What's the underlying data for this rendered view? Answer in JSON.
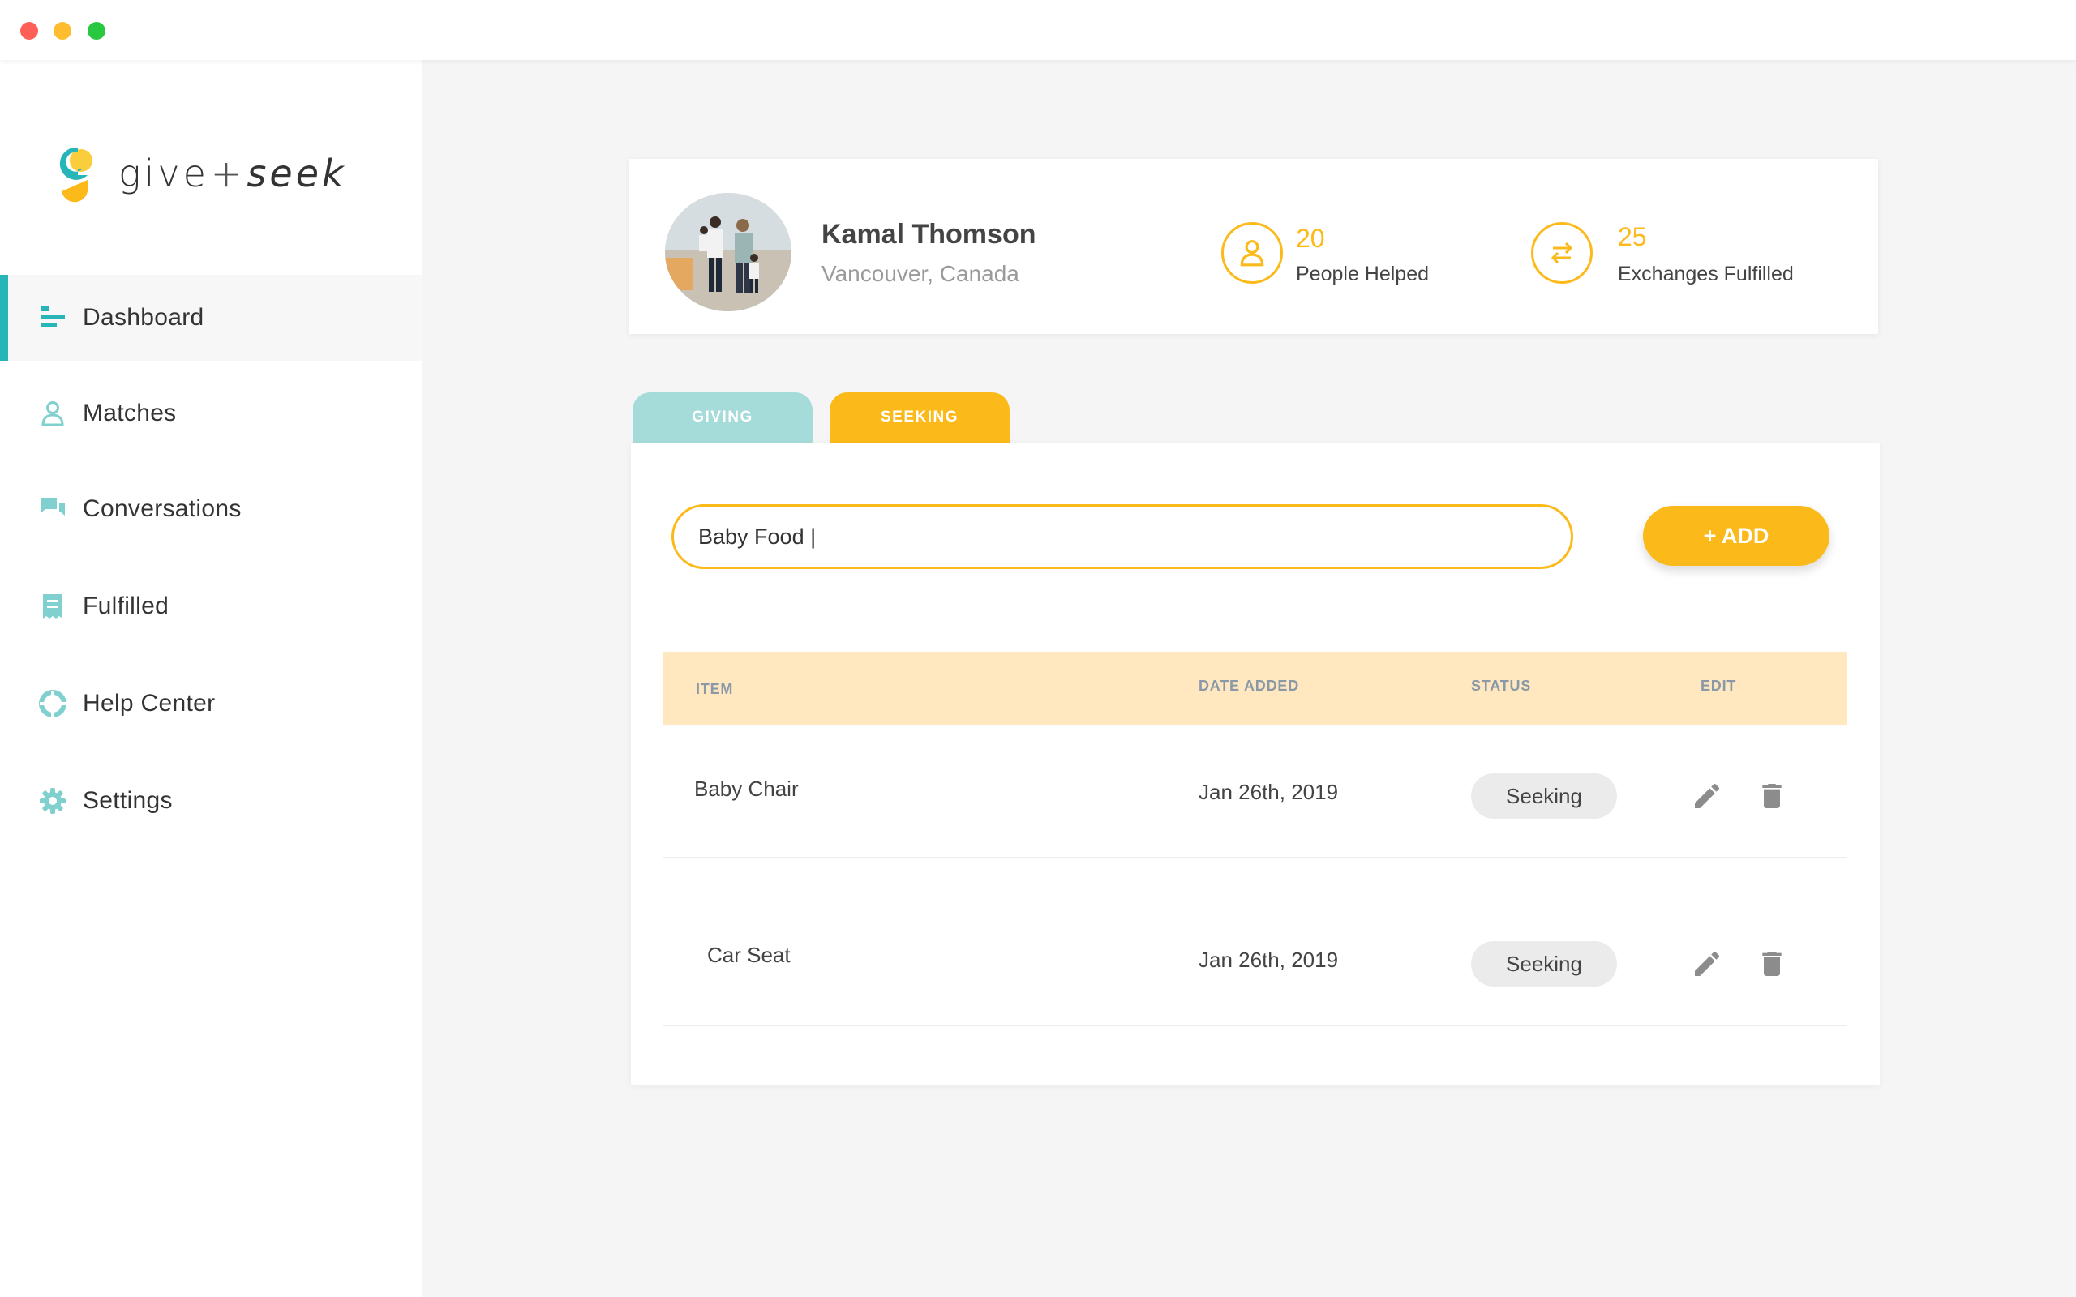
{
  "window": {
    "controls": [
      "close",
      "minimize",
      "maximize"
    ]
  },
  "brand": {
    "give": "give",
    "plus": "+",
    "seek": "seek",
    "logo_icon": "give-seek-logo-icon"
  },
  "sidebar": {
    "items": [
      {
        "label": "Dashboard",
        "icon": "dashboard-icon",
        "active": true
      },
      {
        "label": "Matches",
        "icon": "person-icon",
        "active": false
      },
      {
        "label": "Conversations",
        "icon": "chat-icon",
        "active": false
      },
      {
        "label": "Fulfilled",
        "icon": "receipt-icon",
        "active": false
      },
      {
        "label": "Help Center",
        "icon": "lifebuoy-icon",
        "active": false
      },
      {
        "label": "Settings",
        "icon": "gear-icon",
        "active": false
      }
    ]
  },
  "profile": {
    "name": "Kamal Thomson",
    "location": "Vancouver, Canada",
    "stats": [
      {
        "value": "20",
        "label": "People Helped",
        "icon": "person-icon"
      },
      {
        "value": "25",
        "label": "Exchanges Fulfilled",
        "icon": "exchange-arrows-icon"
      }
    ]
  },
  "tabs": [
    {
      "label": "GIVING",
      "active": false
    },
    {
      "label": "SEEKING",
      "active": true
    }
  ],
  "search": {
    "value": "Baby Food |"
  },
  "add_button": {
    "label": "+ ADD"
  },
  "table": {
    "headers": {
      "item": "ITEM",
      "date": "DATE ADDED",
      "status": "STATUS",
      "edit": "EDIT"
    },
    "rows": [
      {
        "item": "Baby Chair",
        "date": "Jan 26th, 2019",
        "status": "Seeking"
      },
      {
        "item": "Car Seat",
        "date": "Jan 26th, 2019",
        "status": "Seeking"
      }
    ]
  },
  "colors": {
    "accent": "#fbba1a",
    "teal": "#27b5b8",
    "giving_tab": "#a5dbd9",
    "table_header": "#ffe8bf"
  }
}
